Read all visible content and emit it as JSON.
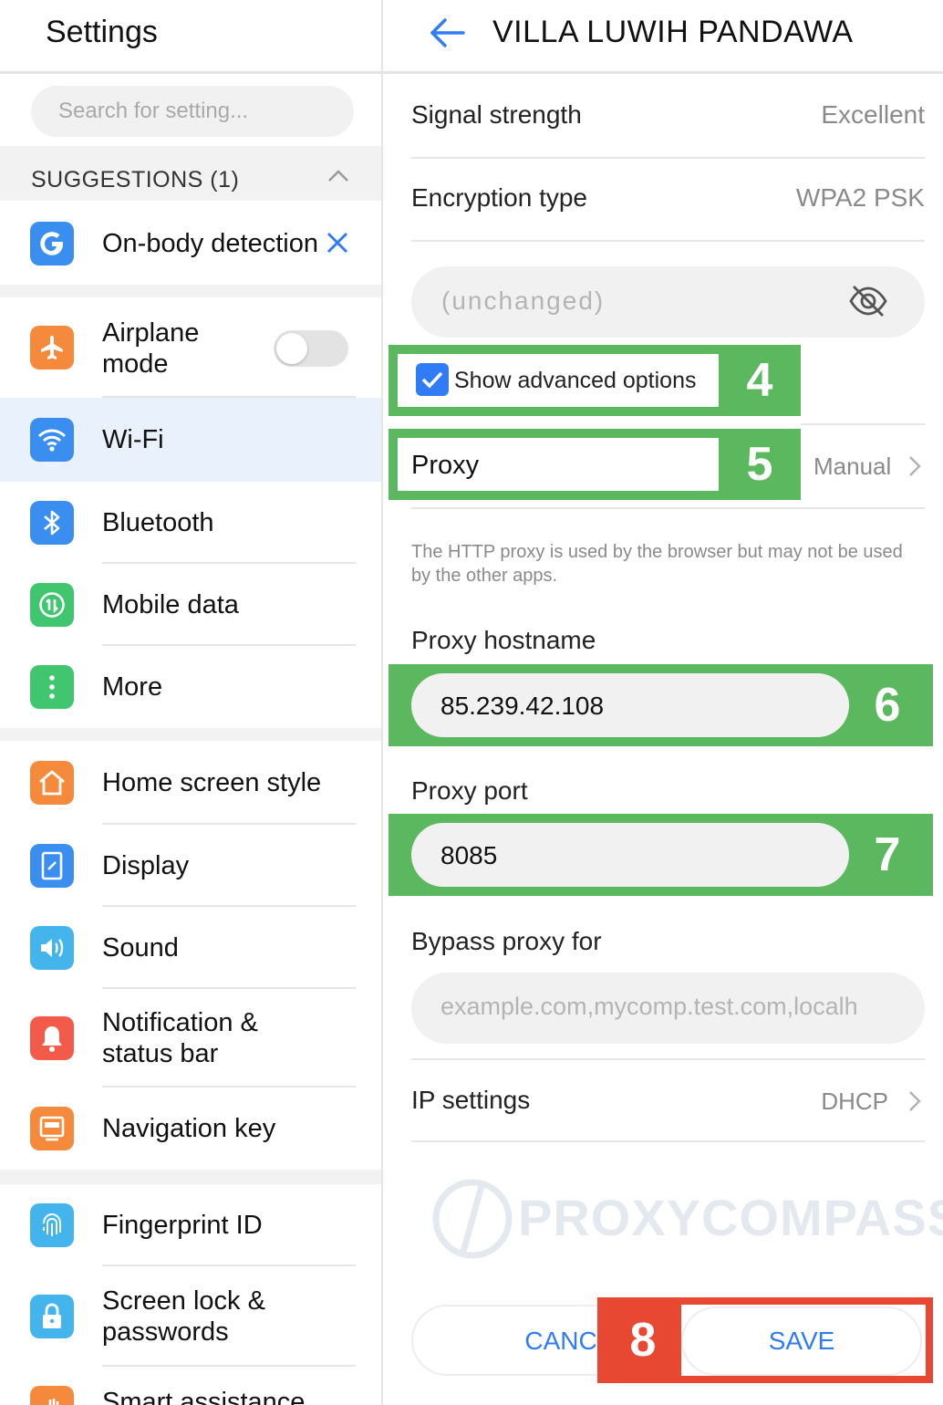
{
  "left": {
    "title": "Settings",
    "search_placeholder": "Search for setting...",
    "suggestions_label": "SUGGESTIONS (1)",
    "suggestion": {
      "label": "On-body detection",
      "icon": "google-g-icon"
    },
    "items": [
      {
        "label": "Airplane mode",
        "line1": "Airplane",
        "line2": "mode",
        "icon": "airplane-icon",
        "color": "#f58a3c",
        "toggle": "off"
      },
      {
        "label": "Wi-Fi",
        "icon": "wifi-icon",
        "color": "#3a8ef0",
        "selected": true
      },
      {
        "label": "Bluetooth",
        "icon": "bluetooth-icon",
        "color": "#3a8ef0"
      },
      {
        "label": "Mobile data",
        "icon": "mobile-data-icon",
        "color": "#3fc66e"
      },
      {
        "label": "More",
        "icon": "more-icon",
        "color": "#3fc66e"
      },
      {
        "label": "Home screen style",
        "icon": "home-icon",
        "color": "#f58a3c"
      },
      {
        "label": "Display",
        "icon": "display-icon",
        "color": "#3a8ef0"
      },
      {
        "label": "Sound",
        "icon": "sound-icon",
        "color": "#43b5ec"
      },
      {
        "label": "Notification & status bar",
        "line1": "Notification &",
        "line2": "status bar",
        "icon": "notification-icon",
        "color": "#f25b4a"
      },
      {
        "label": "Navigation key",
        "icon": "navigation-key-icon",
        "color": "#f58a3c"
      },
      {
        "label": "Fingerprint ID",
        "icon": "fingerprint-icon",
        "color": "#43b5ec"
      },
      {
        "label": "Screen lock & passwords",
        "line1": "Screen lock &",
        "line2": "passwords",
        "icon": "lock-icon",
        "color": "#43b5ec"
      },
      {
        "label": "Smart assistance",
        "icon": "hand-icon",
        "color": "#f58a3c"
      }
    ]
  },
  "right": {
    "title": "VILLA LUWIH PANDAWA",
    "signal_label": "Signal strength",
    "signal_value": "Excellent",
    "encryption_label": "Encryption type",
    "encryption_value": "WPA2 PSK",
    "password_placeholder": "(unchanged)",
    "advanced_label": "Show advanced options",
    "advanced_checked": true,
    "proxy_label": "Proxy",
    "proxy_value": "Manual",
    "proxy_note": "The HTTP proxy is used by the browser but may not be used by the other apps.",
    "hostname_label": "Proxy hostname",
    "hostname_value": "85.239.42.108",
    "port_label": "Proxy port",
    "port_value": "8085",
    "bypass_label": "Bypass proxy for",
    "bypass_placeholder": "example.com,mycomp.test.com,localh",
    "ip_label": "IP settings",
    "ip_value": "DHCP",
    "cancel_label": "CANCEL",
    "save_label": "SAVE",
    "watermark": "PROXYCOMPASS"
  },
  "annotations": {
    "n4": "4",
    "n5": "5",
    "n6": "6",
    "n7": "7",
    "n8": "8"
  },
  "colors": {
    "accent": "#2f7cf6",
    "highlight_green": "#5cb85f",
    "highlight_red": "#e84732",
    "selected_row": "#e8f1fc"
  }
}
